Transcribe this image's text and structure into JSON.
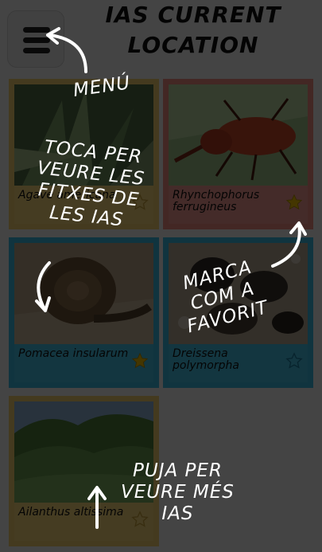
{
  "header": {
    "title_line1": "IAS CURRENT",
    "title_line2": "LOCATION"
  },
  "species": [
    {
      "name": "Agave americana",
      "color": "yellow",
      "favorite": false
    },
    {
      "name": "Rhynchophorus ferrugineus",
      "color": "red",
      "favorite": true
    },
    {
      "name": "Pomacea insularum",
      "color": "blue",
      "favorite": true
    },
    {
      "name": "Dreissena polymorpha",
      "color": "blue",
      "favorite": false
    },
    {
      "name": "Ailanthus altissima",
      "color": "yellow",
      "favorite": false
    }
  ],
  "tutorial": {
    "menu_hint": "MENÚ",
    "tap_hint": "TOCA PER\nVEURE LES\nFITXES DE\nLES IAS",
    "favorite_hint": "MARCA\nCOM A\nFAVORIT",
    "scroll_hint": "PUJA PER\nVEURE MÉS\nIAS"
  },
  "colors": {
    "yellow": "#f4cf6f",
    "red": "#f08c83",
    "blue": "#3bbbe0",
    "star_active": "#f2c200"
  },
  "icons": {
    "menu": "hamburger-icon",
    "favorite": "star-icon",
    "arrows": "curved-arrow-icon"
  }
}
